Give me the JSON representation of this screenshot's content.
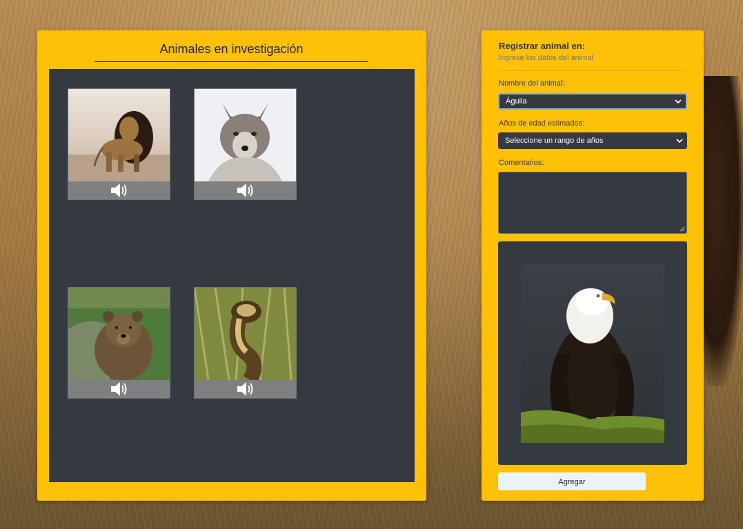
{
  "gallery": {
    "title": "Animales en investigación",
    "animals": [
      {
        "name": "lion",
        "icon": "speaker-icon"
      },
      {
        "name": "wolf",
        "icon": "speaker-icon"
      },
      {
        "name": "bear",
        "icon": "speaker-icon"
      },
      {
        "name": "snake",
        "icon": "speaker-icon"
      }
    ]
  },
  "form": {
    "title": "Registrar animal en:",
    "subtitle": "Ingrese los datos del animal",
    "animal_name": {
      "label": "Nombre del animal:",
      "selected": "Águila"
    },
    "age": {
      "label": "Años de edad estimados:",
      "selected": "Seleccione un rango de años"
    },
    "comments": {
      "label": "Comentarios:",
      "value": ""
    },
    "submit_label": "Agregar"
  },
  "colors": {
    "panel": "#ffc107",
    "dark": "#343a40",
    "audio_bar": "#7f7f7f",
    "button": "#eaf3f8"
  }
}
